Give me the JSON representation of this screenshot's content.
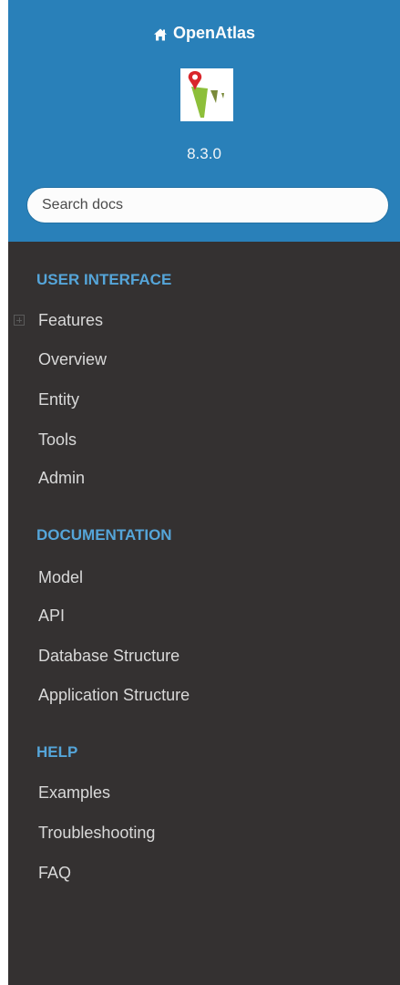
{
  "header": {
    "project_name": "OpenAtlas",
    "version": "8.3.0",
    "brand_color": "#2980b9",
    "icons": {
      "home": "home-icon",
      "logo": "openatlas-logo"
    }
  },
  "search": {
    "placeholder": "Search docs",
    "value": ""
  },
  "sidebar_bg": "#343131",
  "caption_color": "#55a5d9",
  "nav": {
    "sections": [
      {
        "caption": "USER INTERFACE",
        "items": [
          {
            "label": "Features",
            "expandable": true
          },
          {
            "label": "Overview"
          },
          {
            "label": "Entity"
          },
          {
            "label": "Tools"
          },
          {
            "label": "Admin"
          }
        ]
      },
      {
        "caption": "DOCUMENTATION",
        "items": [
          {
            "label": "Model"
          },
          {
            "label": "API"
          },
          {
            "label": "Database Structure"
          },
          {
            "label": "Application Structure"
          }
        ]
      },
      {
        "caption": "HELP",
        "items": [
          {
            "label": "Examples"
          },
          {
            "label": "Troubleshooting"
          },
          {
            "label": "FAQ"
          }
        ]
      }
    ]
  }
}
